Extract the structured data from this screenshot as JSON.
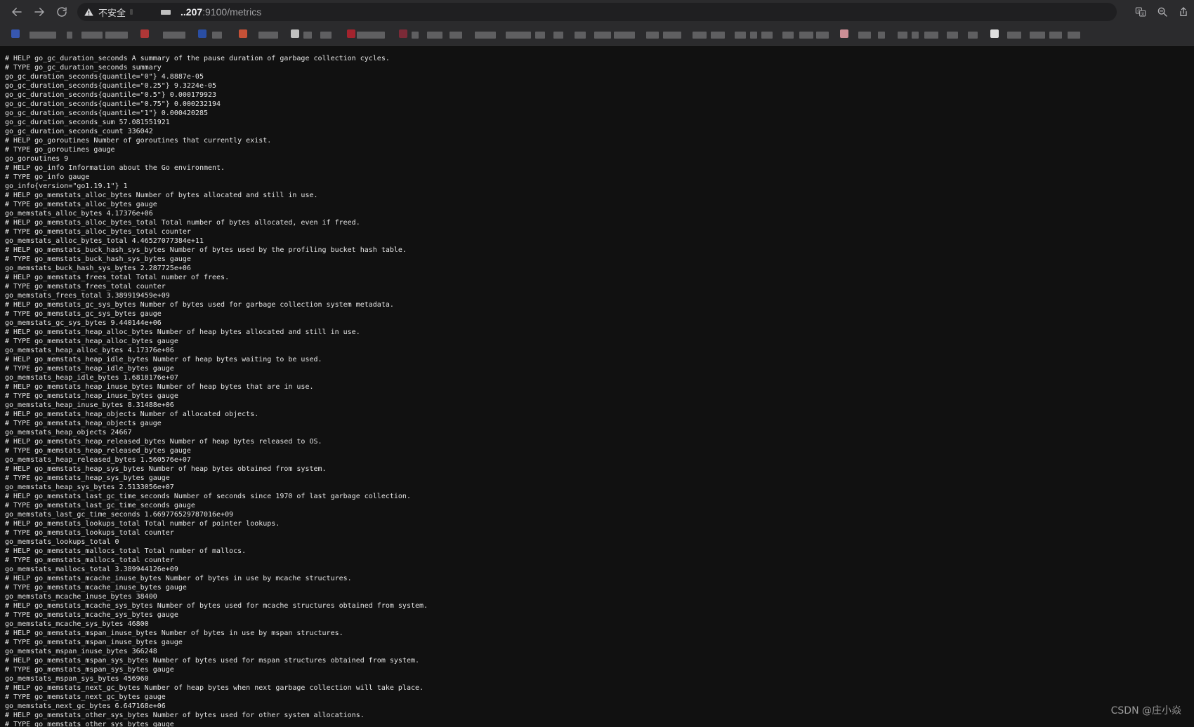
{
  "address_bar": {
    "security_label": "不安全",
    "host": "..207",
    "port_path": ":9100/metrics"
  },
  "icons": {
    "back": "arrow-left-icon",
    "forward": "arrow-right-icon",
    "reload": "reload-icon",
    "warning": "warning-triangle-icon",
    "translate": "translate-icon",
    "zoom": "zoom-icon",
    "share": "share-icon"
  },
  "colors": {
    "page_bg": "#111111",
    "toolbar_bg": "#2b2b2d",
    "text": "#e6e6e6"
  },
  "metrics_lines": [
    "# HELP go_gc_duration_seconds A summary of the pause duration of garbage collection cycles.",
    "# TYPE go_gc_duration_seconds summary",
    "go_gc_duration_seconds{quantile=\"0\"} 4.8887e-05",
    "go_gc_duration_seconds{quantile=\"0.25\"} 9.3224e-05",
    "go_gc_duration_seconds{quantile=\"0.5\"} 0.000179923",
    "go_gc_duration_seconds{quantile=\"0.75\"} 0.000232194",
    "go_gc_duration_seconds{quantile=\"1\"} 0.000420285",
    "go_gc_duration_seconds_sum 57.081551921",
    "go_gc_duration_seconds_count 336042",
    "# HELP go_goroutines Number of goroutines that currently exist.",
    "# TYPE go_goroutines gauge",
    "go_goroutines 9",
    "# HELP go_info Information about the Go environment.",
    "# TYPE go_info gauge",
    "go_info{version=\"go1.19.1\"} 1",
    "# HELP go_memstats_alloc_bytes Number of bytes allocated and still in use.",
    "# TYPE go_memstats_alloc_bytes gauge",
    "go_memstats_alloc_bytes 4.17376e+06",
    "# HELP go_memstats_alloc_bytes_total Total number of bytes allocated, even if freed.",
    "# TYPE go_memstats_alloc_bytes_total counter",
    "go_memstats_alloc_bytes_total 4.46527077384e+11",
    "# HELP go_memstats_buck_hash_sys_bytes Number of bytes used by the profiling bucket hash table.",
    "# TYPE go_memstats_buck_hash_sys_bytes gauge",
    "go_memstats_buck_hash_sys_bytes 2.287725e+06",
    "# HELP go_memstats_frees_total Total number of frees.",
    "# TYPE go_memstats_frees_total counter",
    "go_memstats_frees_total 3.389919459e+09",
    "# HELP go_memstats_gc_sys_bytes Number of bytes used for garbage collection system metadata.",
    "# TYPE go_memstats_gc_sys_bytes gauge",
    "go_memstats_gc_sys_bytes 9.440144e+06",
    "# HELP go_memstats_heap_alloc_bytes Number of heap bytes allocated and still in use.",
    "# TYPE go_memstats_heap_alloc_bytes gauge",
    "go_memstats_heap_alloc_bytes 4.17376e+06",
    "# HELP go_memstats_heap_idle_bytes Number of heap bytes waiting to be used.",
    "# TYPE go_memstats_heap_idle_bytes gauge",
    "go_memstats_heap_idle_bytes 1.6818176e+07",
    "# HELP go_memstats_heap_inuse_bytes Number of heap bytes that are in use.",
    "# TYPE go_memstats_heap_inuse_bytes gauge",
    "go_memstats_heap_inuse_bytes 8.31488e+06",
    "# HELP go_memstats_heap_objects Number of allocated objects.",
    "# TYPE go_memstats_heap_objects gauge",
    "go_memstats_heap_objects 24667",
    "# HELP go_memstats_heap_released_bytes Number of heap bytes released to OS.",
    "# TYPE go_memstats_heap_released_bytes gauge",
    "go_memstats_heap_released_bytes 1.560576e+07",
    "# HELP go_memstats_heap_sys_bytes Number of heap bytes obtained from system.",
    "# TYPE go_memstats_heap_sys_bytes gauge",
    "go_memstats_heap_sys_bytes 2.5133056e+07",
    "# HELP go_memstats_last_gc_time_seconds Number of seconds since 1970 of last garbage collection.",
    "# TYPE go_memstats_last_gc_time_seconds gauge",
    "go_memstats_last_gc_time_seconds 1.669776529787016e+09",
    "# HELP go_memstats_lookups_total Total number of pointer lookups.",
    "# TYPE go_memstats_lookups_total counter",
    "go_memstats_lookups_total 0",
    "# HELP go_memstats_mallocs_total Total number of mallocs.",
    "# TYPE go_memstats_mallocs_total counter",
    "go_memstats_mallocs_total 3.389944126e+09",
    "# HELP go_memstats_mcache_inuse_bytes Number of bytes in use by mcache structures.",
    "# TYPE go_memstats_mcache_inuse_bytes gauge",
    "go_memstats_mcache_inuse_bytes 38400",
    "# HELP go_memstats_mcache_sys_bytes Number of bytes used for mcache structures obtained from system.",
    "# TYPE go_memstats_mcache_sys_bytes gauge",
    "go_memstats_mcache_sys_bytes 46800",
    "# HELP go_memstats_mspan_inuse_bytes Number of bytes in use by mspan structures.",
    "# TYPE go_memstats_mspan_inuse_bytes gauge",
    "go_memstats_mspan_inuse_bytes 366248",
    "# HELP go_memstats_mspan_sys_bytes Number of bytes used for mspan structures obtained from system.",
    "# TYPE go_memstats_mspan_sys_bytes gauge",
    "go_memstats_mspan_sys_bytes 456960",
    "# HELP go_memstats_next_gc_bytes Number of heap bytes when next garbage collection will take place.",
    "# TYPE go_memstats_next_gc_bytes gauge",
    "go_memstats_next_gc_bytes 6.647168e+06",
    "# HELP go_memstats_other_sys_bytes Number of bytes used for other system allocations.",
    "# TYPE go_memstats_other_sys_bytes gauge"
  ],
  "watermark": "CSDN @庄小焱"
}
